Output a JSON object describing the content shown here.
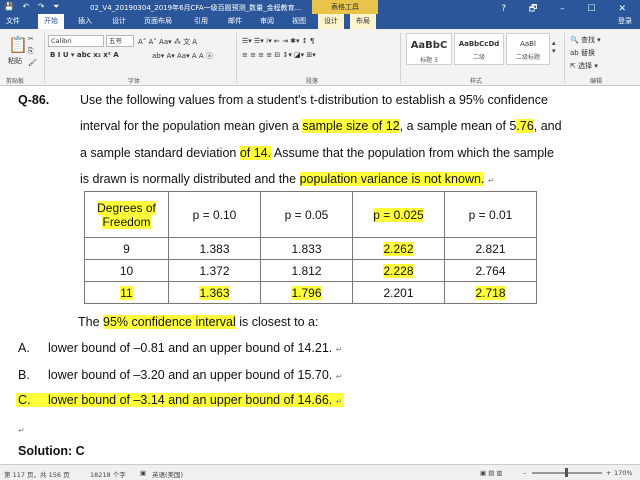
{
  "titlebar": {
    "quick_access": "💾 ↶ ↷ ⏷",
    "doc_title": "02_V4_20190304_2019年6月CFA一级百题预测_数量_金程教育...",
    "context_tools": "表格工具",
    "window_buttons": "? 🗗 – ☐ ✕"
  },
  "tabs": [
    "文件",
    "开始",
    "插入",
    "设计",
    "页面布局",
    "引用",
    "邮件",
    "审阅",
    "视图",
    "设计",
    "布局"
  ],
  "login_label": "登录",
  "ribbon": {
    "paste_label": "粘贴",
    "clipboard_label": "剪贴板",
    "font_name": "Calibri",
    "font_size": "五号",
    "font_row1": "A˄ A˅ Aa▾ ⁂ 文 A",
    "font_row2": "B  I  U ▾ abc x₂ x² A",
    "font_row3": "ab▾ A▾ Aa▾ A A ⓐ",
    "font_group_label": "字体",
    "para_row1": "☰▾ ☰▾ ⁞▾ ⇤ ⇥ ✱▾ ↕ ¶",
    "para_row2": "≡ ≡ ≡ ≡ ⊟ ↕▾ ◪▾ ⊞▾",
    "para_group_label": "段落",
    "styles": [
      {
        "sample": "AaBbC",
        "name": "标题 3"
      },
      {
        "sample": "AaBbCcDd",
        "name": "二级"
      },
      {
        "sample": "AaBl",
        "name": "二级标题"
      }
    ],
    "styles_group_label": "样式",
    "edit_find": "🔍 查找 ▾",
    "edit_replace": "ab 替换",
    "edit_select": "⇱ 选择 ▾",
    "edit_group_label": "编辑"
  },
  "document": {
    "question_number": "Q-86.",
    "para_line1": "Use the following values from a student's t-distribution to establish a 95% confidence",
    "para_line2_pre": "interval for the population mean given a ",
    "para_line2_hl1": "sample size of 12",
    "para_line2_mid": ", a sample mean of 5",
    "para_line2_hl2": ".76",
    "para_line2_post": ", and",
    "para_line3_pre": "a sample standard deviation ",
    "para_line3_hl": "of 14.",
    "para_line3_post": " Assume that the population from which the sample",
    "para_line4_pre": "is drawn is normally distributed and the ",
    "para_line4_hl": "population variance is not known.",
    "paragraph_mark": "↵",
    "table": {
      "header_line1": "Degrees of",
      "header_line2": "Freedom",
      "columns": [
        "p = 0.10",
        "p = 0.05",
        "p = 0.025",
        "p = 0.01"
      ],
      "rows": [
        {
          "df": "9",
          "values": [
            "1.383",
            "1.833",
            "2.262",
            "2.821"
          ]
        },
        {
          "df": "10",
          "values": [
            "1.372",
            "1.812",
            "2.228",
            "2.764"
          ]
        },
        {
          "df": "11",
          "values": [
            "1.363",
            "1.796",
            "2.201",
            "2.718"
          ]
        }
      ]
    },
    "closest_pre": "The ",
    "closest_hl": "95% confidence interval",
    "closest_post": " is closest to a:",
    "options": [
      {
        "letter": "A.",
        "text": "lower bound of –0.81 and an upper bound of 14.21."
      },
      {
        "letter": "B.",
        "text": "lower bound of –3.20 and an upper bound of 15.70."
      },
      {
        "letter": "C.",
        "text": "lower bound of –3.14 and an upper bound of 14.66."
      }
    ],
    "solution_label": "Solution: C"
  },
  "statusbar": {
    "page": "第 117 页，共 156 页",
    "words": "18218 个字",
    "proof_icon": "▣",
    "language": "英语(美国)",
    "view_icons": "▣ ▤ ▥",
    "zoom_minus": "–",
    "zoom_plus": "+",
    "zoom": "170%"
  }
}
